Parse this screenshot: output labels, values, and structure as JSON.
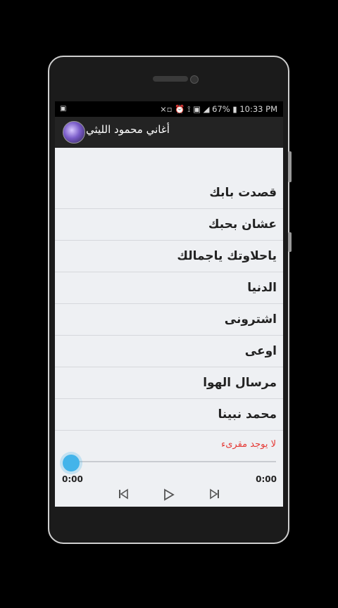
{
  "statusbar": {
    "left_icon": "▣",
    "icons": "⨯▫ ⏰ ⟟ ▣ ◢",
    "battery": "67%",
    "time": "10:33 PM"
  },
  "app": {
    "title": "أغاني محمود الليثي",
    "avatar_icon": "avatar-icon"
  },
  "songs": [
    "قصدت بابك",
    "عشان بحبك",
    "ياحلاوتك ياجمالك",
    "الدنيا",
    "اشترونى",
    "اوعى",
    "مرسال الهوا",
    "محمد نبينا"
  ],
  "player": {
    "status_text": "لا يوجد مقرىء",
    "elapsed": "0:00",
    "duration": "0:00",
    "progress": 0,
    "prev_icon": "skip-previous-icon",
    "play_icon": "play-icon",
    "next_icon": "skip-next-icon"
  },
  "colors": {
    "accent": "#43b4ea",
    "error": "#e53935",
    "appbar": "#232323"
  }
}
